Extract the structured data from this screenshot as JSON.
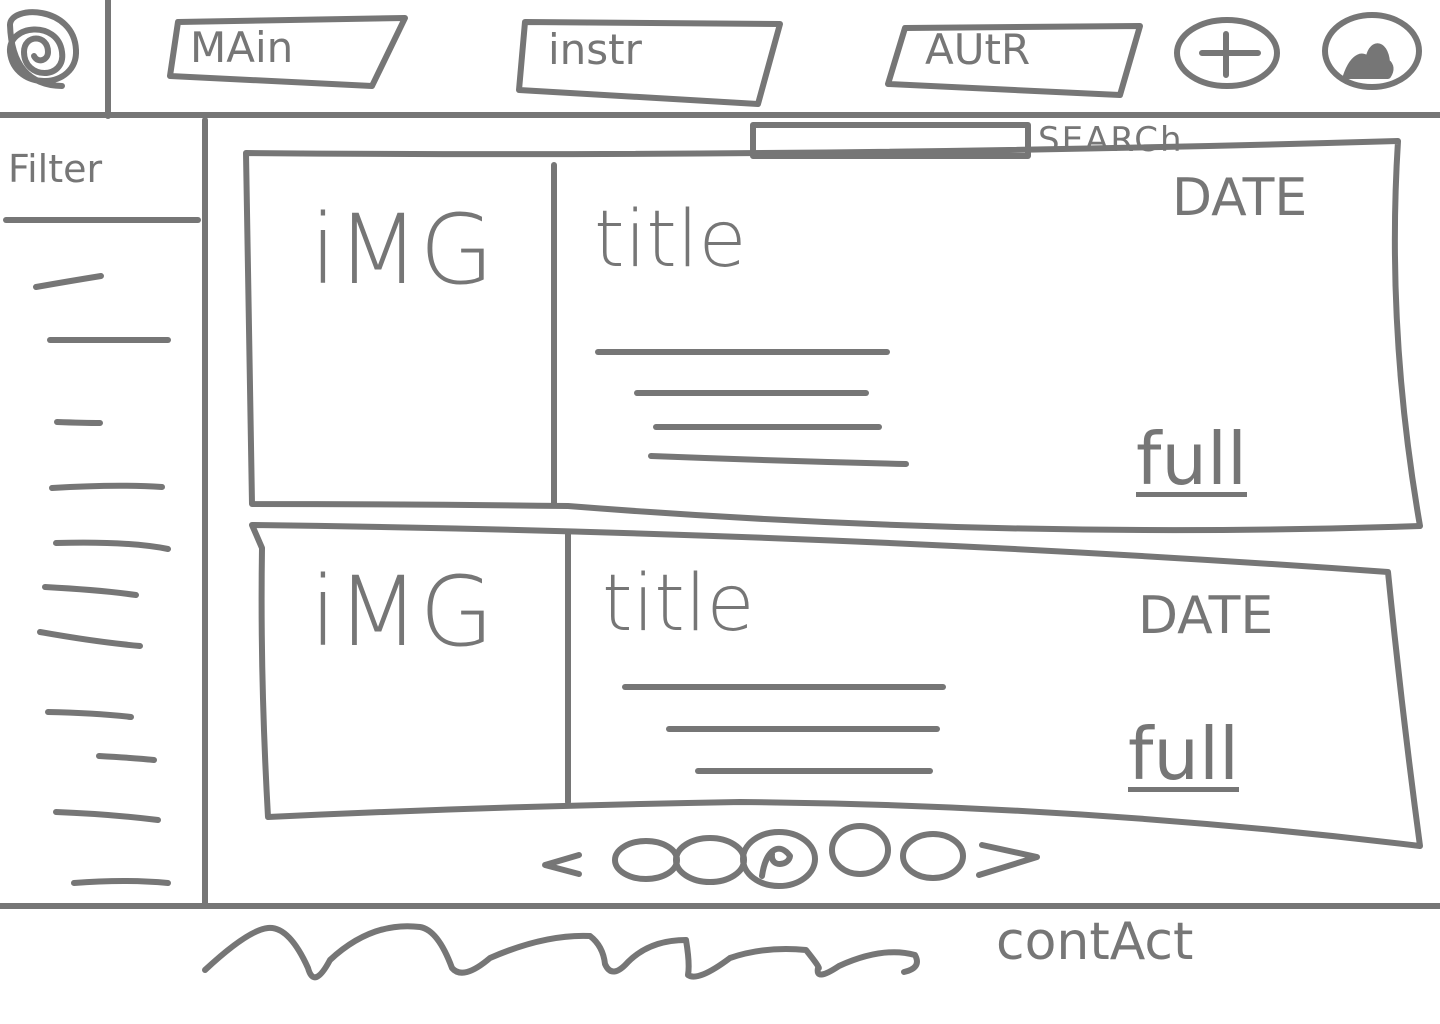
{
  "header": {
    "logo_icon": "spiral-logo-icon",
    "tabs": [
      {
        "label": "MAin"
      },
      {
        "label": "instr"
      },
      {
        "label": "AUtR"
      }
    ],
    "add_icon": "plus-icon",
    "profile_icon": "user-avatar-icon"
  },
  "sidebar": {
    "title": "Filter",
    "item_count_visible": 12
  },
  "search": {
    "label": "SEARCh",
    "value": ""
  },
  "cards": [
    {
      "image_label": "iMG",
      "title": "title",
      "date": "DATE",
      "link": "full"
    },
    {
      "image_label": "iMG",
      "title": "title",
      "date": "DATE",
      "link": "full"
    }
  ],
  "pagination": {
    "prev_label": "<",
    "next_label": ">",
    "active_page_label": "R"
  },
  "footer": {
    "contact_label": "contAct"
  },
  "colors": {
    "stroke": "#767676",
    "background": "#ffffff"
  }
}
